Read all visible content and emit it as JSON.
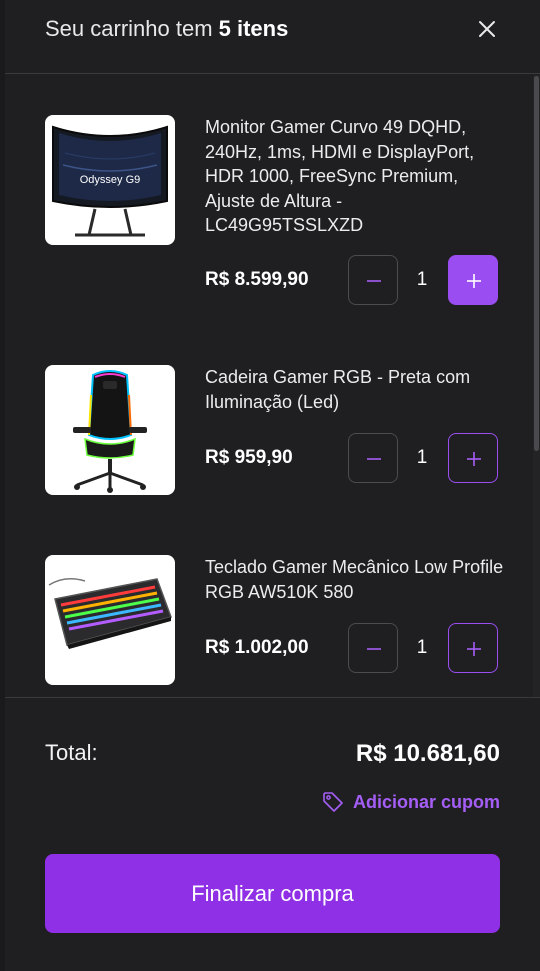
{
  "header": {
    "title_prefix": "Seu carrinho tem ",
    "title_count": "5 itens",
    "close_icon": "close-icon"
  },
  "items": [
    {
      "name": "Monitor Gamer Curvo 49 DQHD, 240Hz, 1ms, HDMI e DisplayPort, HDR 1000, FreeSync Premium, Ajuste de Altura - LC49G95TSSLXZD",
      "price": "R$ 8.599,90",
      "quantity": "1",
      "image_text": "Odyssey G9",
      "image": "monitor-image"
    },
    {
      "name": "Cadeira Gamer RGB - Preta com Iluminação (Led)",
      "price": "R$ 959,90",
      "quantity": "1",
      "image": "chair-image"
    },
    {
      "name": "Teclado Gamer Mecânico Low Profile RGB AW510K 580",
      "price": "R$ 1.002,00",
      "quantity": "1",
      "image": "keyboard-image"
    }
  ],
  "footer": {
    "total_label": "Total:",
    "total_value": "R$ 10.681,60",
    "coupon_label": "Adicionar cupom",
    "coupon_icon": "tag-icon",
    "checkout_label": "Finalizar compra"
  },
  "colors": {
    "accent": "#9a4ef1",
    "checkout": "#8f2fe6",
    "background": "#1f1f22"
  }
}
